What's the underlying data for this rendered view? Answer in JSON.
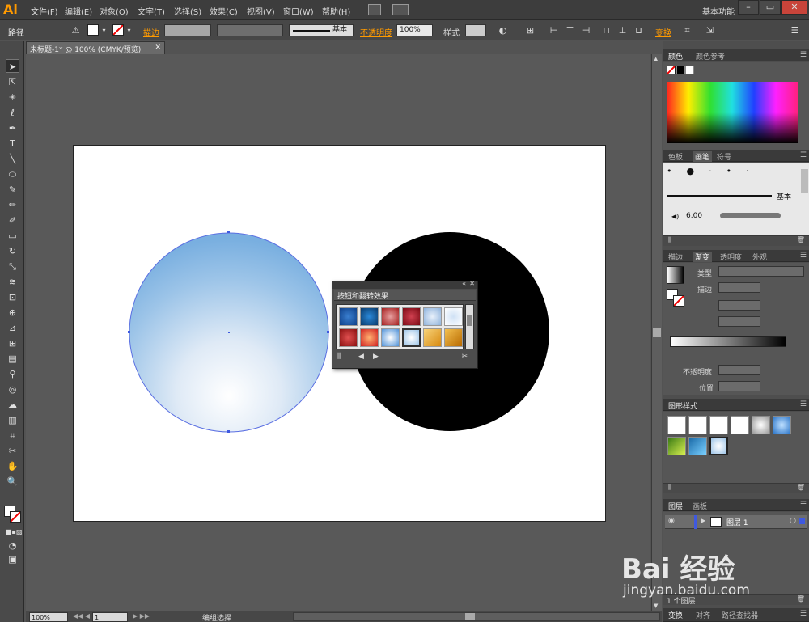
{
  "app": {
    "logo": "Ai",
    "menu": [
      "文件(F)",
      "编辑(E)",
      "对象(O)",
      "文字(T)",
      "选择(S)",
      "效果(C)",
      "视图(V)",
      "窗口(W)",
      "帮助(H)"
    ],
    "workspace": "基本功能"
  },
  "control_bar": {
    "path_label": "路径",
    "stroke_label": "描边",
    "stroke_style": "基本",
    "opacity_label": "不透明度",
    "opacity_value": "100%",
    "style_label": "样式",
    "transform_label": "变换"
  },
  "document": {
    "tab_title": "未标题-1* @ 100% (CMYK/预览)",
    "zoom": "100%",
    "artboard_number": "1",
    "status_text": "编组选择"
  },
  "floating_panel": {
    "title": "按钮和翻转效果"
  },
  "panels": {
    "color_tabs": [
      "颜色",
      "颜色参考"
    ],
    "brush_tabs": [
      "色板",
      "画笔",
      "符号"
    ],
    "brush_basic": "基本",
    "brush_size": "6.00",
    "gradient_tabs": [
      "描边",
      "渐变",
      "透明度",
      "外观"
    ],
    "gradient_type_label": "类型",
    "gradient_stroke_label": "描边",
    "gradient_opacity_label": "不透明度",
    "gradient_position_label": "位置",
    "graphic_styles_tab": "图形样式",
    "layers_tabs": [
      "图层",
      "画板"
    ],
    "layer_name": "图层 1",
    "layer_count": "1 个图层",
    "bottom_tabs": [
      "变换",
      "对齐",
      "路径查找器"
    ]
  },
  "watermark": {
    "brand": "Bai 经验",
    "url": "jingyan.baidu.com"
  },
  "colors": {
    "accent_orange": "#ff9a00",
    "selection_blue": "#3f59e0",
    "sphere_edge": "#7fb3e0",
    "black_circle": "#000000"
  }
}
